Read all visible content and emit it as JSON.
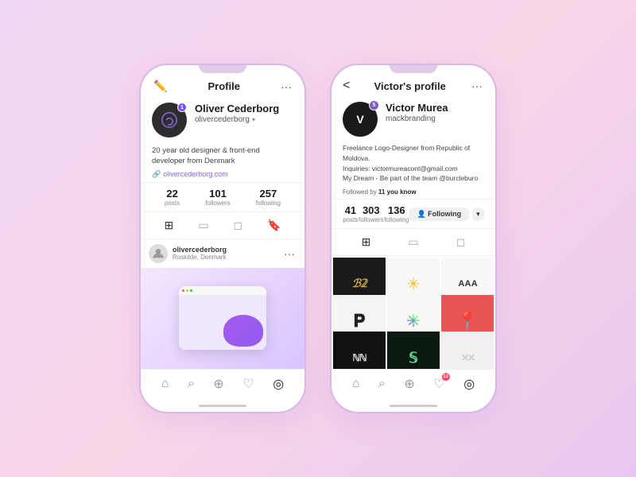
{
  "background": "#f0d6f5",
  "phone1": {
    "header": {
      "title": "Profile",
      "edit_icon": "✏️",
      "more_icon": "···"
    },
    "user": {
      "name": "Oliver Cederborg",
      "username": "olivercederborg",
      "avatar_icon": "🔗",
      "notification_count": "1",
      "bio": "20 year old designer & front-end developer from Denmark",
      "website": "olivercederborg.com"
    },
    "stats": [
      {
        "value": "22",
        "label": "posts"
      },
      {
        "value": "101",
        "label": "followers"
      },
      {
        "value": "257",
        "label": "following"
      }
    ],
    "post": {
      "username": "olivercederborg",
      "location": "Roskilde, Denmark"
    },
    "bottom_nav": [
      {
        "icon": "⌂",
        "label": "home",
        "active": false
      },
      {
        "icon": "⌕",
        "label": "search",
        "active": false
      },
      {
        "icon": "⊕",
        "label": "add",
        "active": false
      },
      {
        "icon": "♡",
        "label": "likes",
        "active": false,
        "badge": ""
      },
      {
        "icon": "◎",
        "label": "profile",
        "active": true
      }
    ]
  },
  "phone2": {
    "header": {
      "back_icon": "<",
      "title": "Victor's profile",
      "more_icon": "···"
    },
    "user": {
      "name": "Victor Murea",
      "username": "mackbranding",
      "initials": "V",
      "level": "5",
      "bio_line1": "Freelance Logo-Designer from Republic of Moldova.",
      "bio_line2": "Inquiries: victormureacont@gmail.com",
      "bio_line3": "My Dream - Be part of the team @burcleburo",
      "followed_by_count": "11",
      "followed_by_text": "you know"
    },
    "stats": [
      {
        "value": "41",
        "label": "posts"
      },
      {
        "value": "303",
        "label": "followers"
      },
      {
        "value": "136",
        "label": "following"
      }
    ],
    "follow_btn_label": "Following",
    "grid_items": [
      {
        "type": "dark",
        "symbol": "𝔻𝟚",
        "desc": "D2 logo"
      },
      {
        "type": "light",
        "symbol": "✳",
        "desc": "sun logo"
      },
      {
        "type": "light",
        "symbol": "ΑΑΑ",
        "desc": "AAA logo"
      },
      {
        "type": "light",
        "symbol": "𝐏",
        "desc": "P logo"
      },
      {
        "type": "light",
        "symbol": "✳",
        "desc": "star logo"
      },
      {
        "type": "coral",
        "symbol": "📍",
        "desc": "pin logo"
      },
      {
        "type": "black-text",
        "symbol": "ℕℕ",
        "desc": "NN logo"
      },
      {
        "type": "black-text",
        "symbol": "𝕊",
        "desc": "S logo"
      },
      {
        "type": "light",
        "symbol": "✕✕",
        "desc": "XX logo"
      }
    ],
    "bottom_nav": [
      {
        "icon": "⌂",
        "label": "home",
        "active": false
      },
      {
        "icon": "⌕",
        "label": "search",
        "active": false
      },
      {
        "icon": "⊕",
        "label": "add",
        "active": false
      },
      {
        "icon": "♡",
        "label": "likes",
        "active": false,
        "badge": "13"
      },
      {
        "icon": "◎",
        "label": "profile",
        "active": true
      }
    ]
  }
}
